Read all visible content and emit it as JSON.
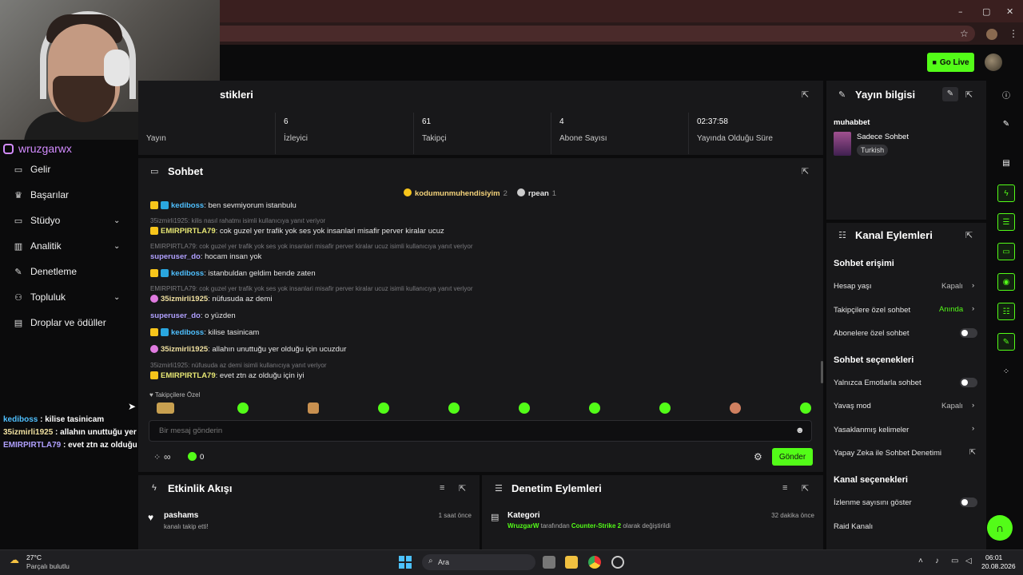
{
  "browser": {
    "window_controls": [
      "–",
      "▢",
      "✕"
    ]
  },
  "header": {
    "go_live_label": "Go Live"
  },
  "webcam": {
    "instagram_handle": "wruzgarwx"
  },
  "sidebar": {
    "items": [
      {
        "label": "Gelir",
        "icon": "wallet-icon",
        "expandable": false
      },
      {
        "label": "Başarılar",
        "icon": "trophy-icon",
        "expandable": false
      },
      {
        "label": "Stüdyo",
        "icon": "studio-icon",
        "expandable": true
      },
      {
        "label": "Analitik",
        "icon": "analytics-icon",
        "expandable": true
      },
      {
        "label": "Denetleme",
        "icon": "wrench-icon",
        "expandable": false
      },
      {
        "label": "Topluluk",
        "icon": "community-icon",
        "expandable": true
      },
      {
        "label": "Droplar ve ödüller",
        "icon": "gift-icon",
        "expandable": false
      }
    ]
  },
  "overlay_chat": [
    {
      "user": "kediboss",
      "text": " : kilise tasinicam"
    },
    {
      "user": "35izmirli1925",
      "text": " : allahın unuttuğu yer olduğu için ucuzdur"
    },
    {
      "user": "EMIRPIRTLA79",
      "text": " : evet ztn az olduğu için iyi"
    }
  ],
  "stats": {
    "title_partial": "stikleri",
    "cells": [
      {
        "value": "",
        "label": "Yayın"
      },
      {
        "value": "6",
        "label": "İzleyici"
      },
      {
        "value": "61",
        "label": "Takipçi"
      },
      {
        "value": "4",
        "label": "Abone Sayısı"
      },
      {
        "value": "02:37:58",
        "label": "Yayında Olduğu Süre"
      }
    ]
  },
  "chat": {
    "title": "Sohbet",
    "pinned": [
      {
        "user": "kodumunmuhendisiyim",
        "count": "2"
      },
      {
        "user": "rpean",
        "count": "1"
      }
    ],
    "messages": [
      {
        "type": "msg",
        "badges": [
          "y",
          "b"
        ],
        "user": "kediboss",
        "ucls": "u-blue",
        "text": ": ben sevmiyorum istanbulu"
      },
      {
        "type": "reply",
        "text": "35izmirli1925: kilis nasıl rahatmı isimli kullanıcıya yanıt veriyor"
      },
      {
        "type": "msg",
        "badges": [
          "y"
        ],
        "user": "EMIRPIRTLA79",
        "ucls": "u-yel",
        "text": ": cok guzel yer trafik yok ses yok insanlari misafir perver kiralar ucuz"
      },
      {
        "type": "reply",
        "text": "EMIRPIRTLA79: cok guzel yer trafik yok ses yok insanlari misafir perver kiralar ucuz isimli kullanıcıya yanıt veriyor"
      },
      {
        "type": "msg",
        "badges": [],
        "user": "superuser_do",
        "ucls": "u-pur",
        "text": ": hocam insan yok"
      },
      {
        "type": "msg",
        "badges": [
          "y",
          "b"
        ],
        "user": "kediboss",
        "ucls": "u-blue",
        "text": ": istanbuldan geldim bende zaten"
      },
      {
        "type": "reply",
        "text": "EMIRPIRTLA79: cok guzel yer trafik yok ses yok insanlari misafir perver kiralar ucuz isimli kullanıcıya yanıt veriyor"
      },
      {
        "type": "msg",
        "badges": [
          "p"
        ],
        "user": "35izmirli1925",
        "ucls": "u-pink",
        "text": ": nüfusuda az demi"
      },
      {
        "type": "msg",
        "badges": [],
        "user": "superuser_do",
        "ucls": "u-pur",
        "text": ": o yüzden"
      },
      {
        "type": "msg",
        "badges": [
          "y",
          "b"
        ],
        "user": "kediboss",
        "ucls": "u-blue",
        "text": ": kilise tasinicam"
      },
      {
        "type": "msg",
        "badges": [
          "p"
        ],
        "user": "35izmirli1925",
        "ucls": "u-pink",
        "text": ": allahın unuttuğu yer olduğu için ucuzdur"
      },
      {
        "type": "reply",
        "text": "35izmirli1925: nüfusuda az demi isimli kullanıcıya yanıt veriyor"
      },
      {
        "type": "msg",
        "badges": [
          "y"
        ],
        "user": "EMIRPIRTLA79",
        "ucls": "u-yel",
        "text": ": evet ztn az olduğu için iyi"
      }
    ],
    "followers_only_label": "Takipçilere Özel",
    "input_placeholder": "Bir mesaj gönderin",
    "points_infinite": "∞",
    "points_count": "0",
    "send_label": "Gönder"
  },
  "activity": {
    "title": "Etkinlik Akışı",
    "items": [
      {
        "user": "pashams",
        "desc": "kanalı takip etti!",
        "time": "1 saat önce"
      }
    ]
  },
  "mod_actions": {
    "title": "Denetim Eylemleri",
    "items": [
      {
        "title": "Kategori",
        "actor": "WruzgarW",
        "mid": " tarafından ",
        "target": "Counter-Strike 2",
        "tail": " olarak değiştirildi",
        "time": "32 dakika önce"
      }
    ]
  },
  "stream_info": {
    "title": "Yayın bilgisi",
    "stream_title": "muhabbet",
    "category": "Sadece Sohbet",
    "language_tag": "Turkish"
  },
  "channel_actions": {
    "title": "Kanal Eylemleri",
    "chat_access_heading": "Sohbet erişimi",
    "account_age_label": "Hesap yaşı",
    "account_age_value": "Kapalı",
    "followers_only_label": "Takipçilere özel sohbet",
    "followers_only_value": "Anında",
    "subs_only_label": "Abonelere özel sohbet",
    "chat_options_heading": "Sohbet seçenekleri",
    "emote_only_label": "Yalnızca Emotlarla sohbet",
    "slow_mode_label": "Yavaş mod",
    "slow_mode_value": "Kapalı",
    "banned_words_label": "Yasaklanmış kelimeler",
    "ai_moderation_label": "Yapay Zeka ile Sohbet Denetimi",
    "channel_options_heading": "Kanal seçenekleri",
    "show_viewcount_label": "İzlenme sayısını göster",
    "raid_label": "Raid Kanalı"
  },
  "taskbar": {
    "weather_temp": "27°C",
    "weather_desc": "Parçalı bulutlu",
    "search_label": "Ara",
    "time": "06:01",
    "date": "20.08.2026"
  },
  "colors": {
    "accent": "#53fc18",
    "panel": "#18181a",
    "background": "#0b0b0c"
  }
}
